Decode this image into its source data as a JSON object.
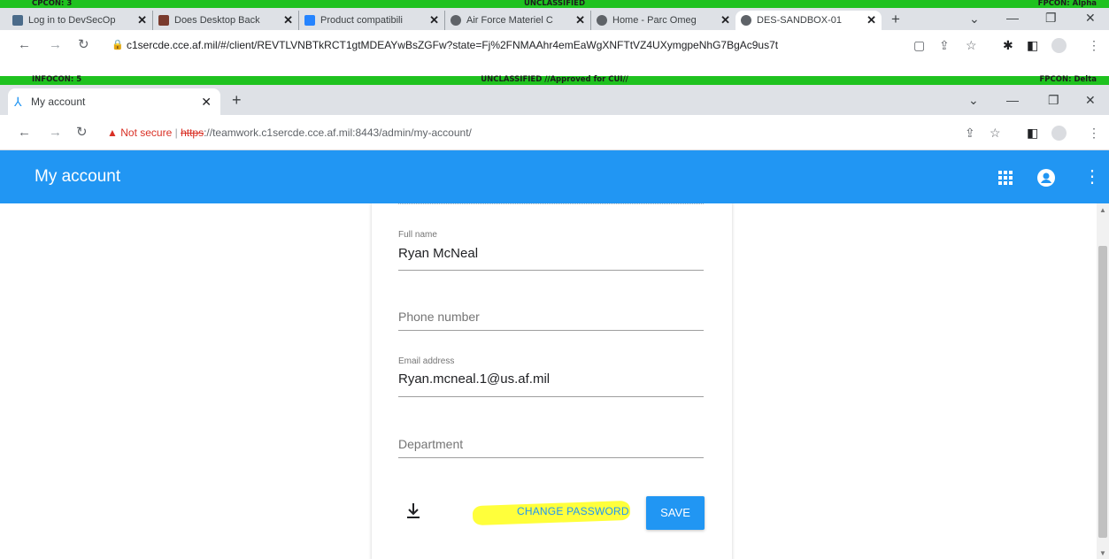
{
  "outer_banner": {
    "left": "CPCON: 3",
    "center": "UNCLASSIFIED",
    "right": "FPCON: Alpha"
  },
  "outer_tabs": [
    {
      "title": "Log in to DevSecOp",
      "color": "#4b6b8a"
    },
    {
      "title": "Does Desktop Back",
      "color": "#7a3b2e"
    },
    {
      "title": "Product compatibili",
      "color": "#2684ff"
    },
    {
      "title": "Air Force Materiel C",
      "color": "#5f6368"
    },
    {
      "title": "Home - Parc Omeg",
      "color": "#5f6368"
    },
    {
      "title": "DES-SANDBOX-01",
      "color": "#5f6368"
    }
  ],
  "outer_url": "c1sercde.cce.af.mil/#/client/REVTLVNBTkRCT1gtMDEAYwBsZGFw?state=Fj%2FNMAAhr4emEaWgXNFTtVZ4UXymgpeNhG7BgAc9us7t",
  "inner_banner": {
    "left": "INFOCON: 5",
    "center": "UNCLASSIFIED //Approved for CUI//",
    "right": "FPCON: Delta"
  },
  "inner_tab": {
    "title": "My account"
  },
  "inner_address": {
    "not_secure": "Not secure",
    "scheme": "https",
    "rest": "://teamwork.c1sercde.cce.af.mil:8443/admin/my-account/"
  },
  "appbar": {
    "title": "My account"
  },
  "form": {
    "full_name": {
      "label": "Full name",
      "value": "Ryan McNeal"
    },
    "phone": {
      "placeholder": "Phone number"
    },
    "email": {
      "label": "Email address",
      "value": "Ryan.mcneal.1@us.af.mil"
    },
    "department": {
      "placeholder": "Department"
    },
    "change_password": "CHANGE PASSWORD",
    "save": "SAVE",
    "highlight_color": "#ffff3b",
    "accent": "#2196f3"
  }
}
